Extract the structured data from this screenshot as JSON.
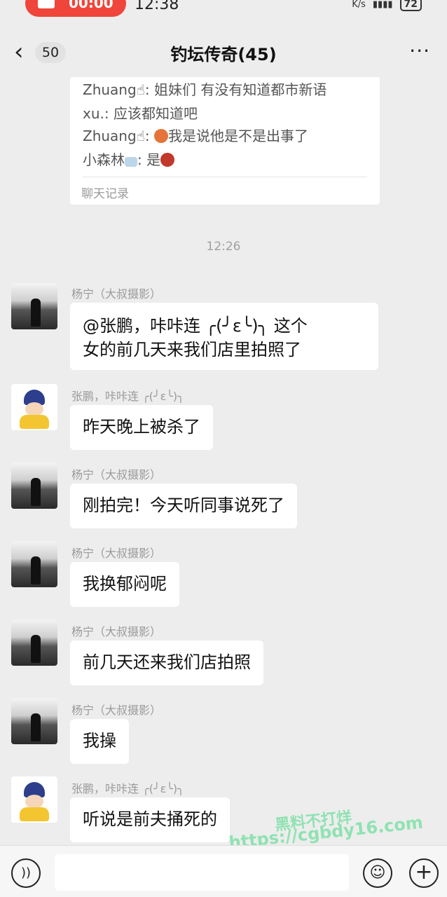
{
  "status_bar": {
    "record_time": "00:00",
    "clock": "12:38",
    "speed_unit": "K/s",
    "battery": "72"
  },
  "header": {
    "back_count": "50",
    "title": "钓坛传奇(45)",
    "more": "···"
  },
  "chat_record": {
    "lines": [
      {
        "name": "Zhuang",
        "sep": ":",
        "text": "姐妹们 有没有知道都市新语"
      },
      {
        "name": "xu.",
        "sep": ":",
        "text": "应该都知道吧"
      },
      {
        "name": "Zhuang",
        "sep": ":",
        "text": "我是说他是不是出事了"
      },
      {
        "name": "小森林",
        "sep": ":",
        "text": "是"
      }
    ],
    "footer": "聊天记录"
  },
  "timestamp": "12:26",
  "messages": [
    {
      "sender": "杨宁（大叔摄影）",
      "text_line1": "@张鹏，咔咔连 ╭(╯ε╰)╮ 这个",
      "text_line2": "女的前几天来我们店里拍照了"
    },
    {
      "sender": "张鹏，咔咔连 ╭(╯ε╰)╮",
      "text_line1": "昨天晚上被杀了"
    },
    {
      "sender": "杨宁（大叔摄影）",
      "text_line1": "刚拍完！今天听同事说死了"
    },
    {
      "sender": "杨宁（大叔摄影）",
      "text_line1": "我换郁闷呢"
    },
    {
      "sender": "杨宁（大叔摄影）",
      "text_line1": "前几天还来我们店拍照"
    },
    {
      "sender": "杨宁（大叔摄影）",
      "text_line1": "我操"
    },
    {
      "sender": "张鹏，咔咔连 ╭(╯ε╰)╮",
      "text_line1": "听说是前夫捅死的"
    }
  ],
  "watermark": {
    "line1": "黑料不打烊",
    "line2": "https://cgbdy16.com"
  },
  "input_bar": {
    "voice_icon": "voice-icon",
    "emoji_icon": "emoji-icon",
    "plus_icon": "plus-icon"
  },
  "colors": {
    "background": "#ededed",
    "bubble": "#ffffff",
    "record_button": "#f0453a",
    "watermark": "#8fe2b2"
  }
}
